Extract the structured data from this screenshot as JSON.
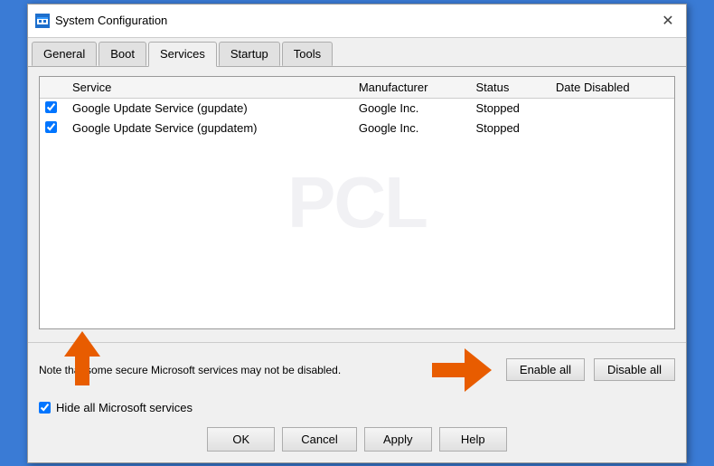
{
  "window": {
    "title": "System Configuration",
    "close_label": "✕"
  },
  "tabs": [
    {
      "id": "general",
      "label": "General"
    },
    {
      "id": "boot",
      "label": "Boot"
    },
    {
      "id": "services",
      "label": "Services",
      "active": true
    },
    {
      "id": "startup",
      "label": "Startup"
    },
    {
      "id": "tools",
      "label": "Tools"
    }
  ],
  "table": {
    "columns": [
      {
        "id": "service",
        "label": "Service"
      },
      {
        "id": "manufacturer",
        "label": "Manufacturer"
      },
      {
        "id": "status",
        "label": "Status"
      },
      {
        "id": "date_disabled",
        "label": "Date Disabled"
      }
    ],
    "rows": [
      {
        "checked": true,
        "service": "Google Update Service (gupdate)",
        "manufacturer": "Google Inc.",
        "status": "Stopped",
        "date_disabled": ""
      },
      {
        "checked": true,
        "service": "Google Update Service (gupdatem)",
        "manufacturer": "Google Inc.",
        "status": "Stopped",
        "date_disabled": ""
      }
    ]
  },
  "note": "Note that some secure Microsoft services may not be disabled.",
  "enable_all": "Enable all",
  "disable_all": "Disable all",
  "hide_microsoft": {
    "checked": true,
    "label": "Hide all Microsoft services"
  },
  "buttons": {
    "ok": "OK",
    "cancel": "Cancel",
    "apply": "Apply",
    "help": "Help"
  }
}
